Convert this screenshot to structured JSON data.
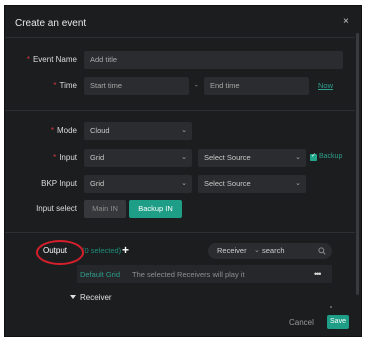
{
  "dialog": {
    "title": "Create an event",
    "close_glyph": "×"
  },
  "event_name": {
    "label": "Event Name",
    "value": "Add title"
  },
  "time": {
    "label": "Time",
    "start": "Start time",
    "separator": "-",
    "end": "End time",
    "now_link": "Now"
  },
  "mode": {
    "label": "Mode",
    "value": "Cloud"
  },
  "input": {
    "label": "Input",
    "type": "Grid",
    "source": "Select Source",
    "backup_label": "Backup",
    "backup_checked": true
  },
  "bkp_input": {
    "label": "BKP Input",
    "type": "Grid",
    "source": "Select Source"
  },
  "input_select": {
    "label": "Input select",
    "main": "Main IN",
    "backup": "Backup IN"
  },
  "output": {
    "label": "Output",
    "selected_text": "(0 selected)",
    "add_glyph": "+",
    "filter": "Receiver",
    "search_placeholder": "search",
    "default_group": "Default Grid",
    "default_group_text": "The selected Receivers will play it",
    "more_glyph": "•••",
    "receiver_header": "Receiver"
  },
  "footer": {
    "cancel": "Cancel",
    "save": "Save"
  },
  "colors": {
    "accent": "#1e9e86",
    "required": "#d8373c",
    "annotation": "#d4202b",
    "background": "#1c1d1f"
  },
  "icons": [
    "close-icon",
    "chevron-down-icon",
    "checkbox-icon",
    "plus-icon",
    "search-icon",
    "more-icon",
    "caret-down-icon"
  ]
}
